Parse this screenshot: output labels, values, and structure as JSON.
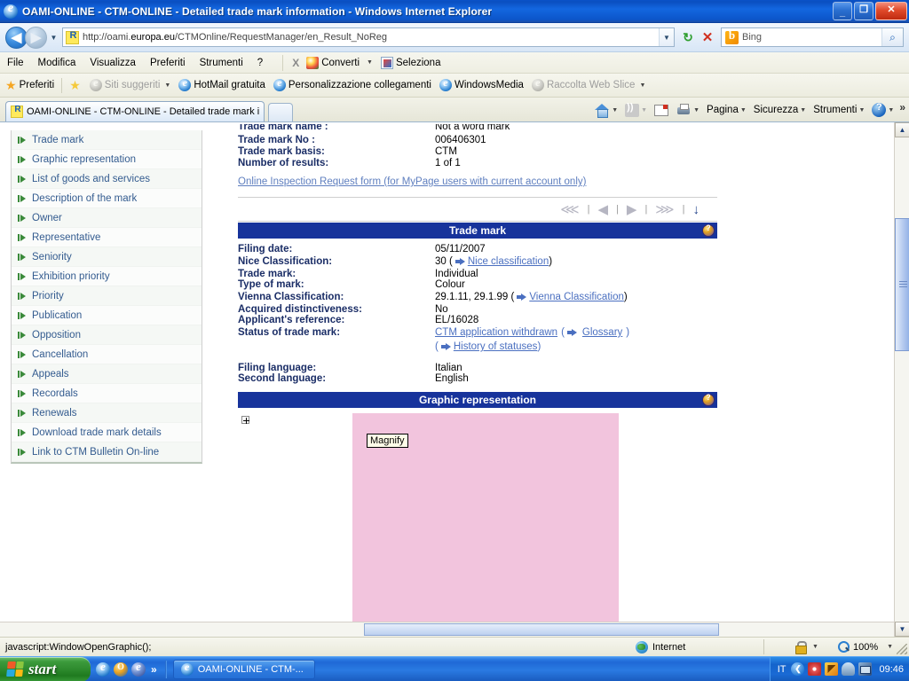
{
  "window": {
    "title": "OAMI-ONLINE - CTM-ONLINE - Detailed trade mark information - Windows Internet Explorer",
    "minimize_label": "_",
    "maximize_label": "❐",
    "close_label": "✕"
  },
  "address_bar": {
    "url_prefix": "http://oami.",
    "url_domain": "europa.eu",
    "url_suffix": "/CTMOnline/RequestManager/en_Result_NoReg",
    "url_full": "http://oami.europa.eu/CTMOnline/RequestManager/en_Result_NoReg",
    "back_glyph": "◀",
    "forward_glyph": "▶",
    "history_caret": "▼",
    "refresh_glyph": "↻",
    "stop_glyph": "✕",
    "search_value": "Bing",
    "search_go_glyph": "⌕"
  },
  "menu_bar": {
    "items": [
      "File",
      "Modifica",
      "Visualizza",
      "Preferiti",
      "Strumenti",
      "?"
    ],
    "convert_close": "X",
    "convert_label": "Converti",
    "select_label": "Seleziona",
    "caret": "▼"
  },
  "favorites_bar": {
    "favorites_label": "Preferiti",
    "items": [
      {
        "label": "Siti suggeriti",
        "dim": true,
        "caret": true
      },
      {
        "label": "HotMail gratuita",
        "dim": false,
        "caret": false
      },
      {
        "label": "Personalizzazione collegamenti",
        "dim": false,
        "caret": false
      },
      {
        "label": "WindowsMedia",
        "dim": false,
        "caret": false
      },
      {
        "label": "Raccolta Web Slice",
        "dim": true,
        "caret": true
      }
    ]
  },
  "tab_bar": {
    "tab_title": "OAMI-ONLINE - CTM-ONLINE - Detailed trade mark inf...",
    "command_items": [
      "Pagina",
      "Sicurezza",
      "Strumenti"
    ],
    "overflow_glyph": "»",
    "caret": "▼"
  },
  "sidebar": {
    "items": [
      {
        "label": "Trade mark"
      },
      {
        "label": "Graphic representation"
      },
      {
        "label": "List of goods and services"
      },
      {
        "label": "Description of the mark"
      },
      {
        "label": "Owner"
      },
      {
        "label": "Representative"
      },
      {
        "label": "Seniority"
      },
      {
        "label": "Exhibition priority"
      },
      {
        "label": "Priority"
      },
      {
        "label": "Publication"
      },
      {
        "label": "Opposition"
      },
      {
        "label": "Cancellation"
      },
      {
        "label": "Appeals"
      },
      {
        "label": "Recordals"
      },
      {
        "label": "Renewals"
      },
      {
        "label": "Download trade mark details"
      },
      {
        "label": "Link to CTM Bulletin On-line"
      }
    ]
  },
  "summary": {
    "rows": [
      {
        "key": "Trade mark name :",
        "value": "Not a word mark"
      },
      {
        "key": "Trade mark No :",
        "value": "006406301"
      },
      {
        "key": "Trade mark basis:",
        "value": "CTM"
      },
      {
        "key": "Number of results:",
        "value": "1 of 1"
      }
    ],
    "inspection_link": "Online Inspection Request form (for MyPage users with current account only)"
  },
  "pager": {
    "first_glyph": "⋘",
    "prev_glyph": "◀",
    "next_glyph": "▶",
    "last_glyph": "⋙",
    "down_glyph": "↓",
    "separator": "|"
  },
  "trade_mark_section": {
    "title": "Trade mark",
    "help_glyph": "?",
    "rows": [
      {
        "key": "Filing date:",
        "value": "05/11/2007",
        "link": "",
        "extra": ""
      },
      {
        "key": "Nice Classification:",
        "value": "30 (",
        "link": "Nice classification",
        "extra": ")"
      },
      {
        "key": "Trade mark:",
        "value": "Individual",
        "link": "",
        "extra": ""
      },
      {
        "key": "Type of mark:",
        "value": "Colour",
        "link": "",
        "extra": ""
      },
      {
        "key": "Vienna Classification:",
        "value": "29.1.11, 29.1.99 (",
        "link": "Vienna Classification",
        "extra": ")"
      },
      {
        "key": "Acquired distinctiveness:",
        "value": "No",
        "link": "",
        "extra": ""
      },
      {
        "key": "Applicant's reference:",
        "value": "EL/16028",
        "link": "",
        "extra": ""
      },
      {
        "key": "Status of trade mark:",
        "value": "",
        "link": "CTM application withdrawn",
        "extra": "",
        "status_open": "(",
        "status_link2": "Glossary",
        "status_close": ")"
      },
      {
        "key": "",
        "value": "(",
        "link": "History of statuses",
        "extra": ")"
      },
      {
        "key": "Filing language:",
        "value": "Italian",
        "link": "",
        "extra": ""
      },
      {
        "key": "Second language:",
        "value": "English",
        "link": "",
        "extra": ""
      }
    ]
  },
  "graphic_section": {
    "title": "Graphic representation",
    "help_glyph": "?",
    "expand_glyph": "+",
    "magnify_tooltip": "Magnify",
    "image_color": "#f2c4dd"
  },
  "status_bar": {
    "message": "javascript:WindowOpenGraphic();",
    "zone": "Internet",
    "zoom": "100%",
    "caret": "▼"
  },
  "taskbar": {
    "start_label": "start",
    "quicklaunch_chevron": "»",
    "task_label": "OAMI-ONLINE - CTM-...",
    "tray_language": "IT",
    "tray_chevron": "❮",
    "clock": "09:46"
  },
  "colors": {
    "section_header_bg": "#17339b",
    "title_bar_blue": "#1367e0",
    "link_blue": "#4a6fc0",
    "sidebar_link": "#335b8f",
    "key_navy": "#1a2d66",
    "mark_pink": "#f2c4dd"
  }
}
